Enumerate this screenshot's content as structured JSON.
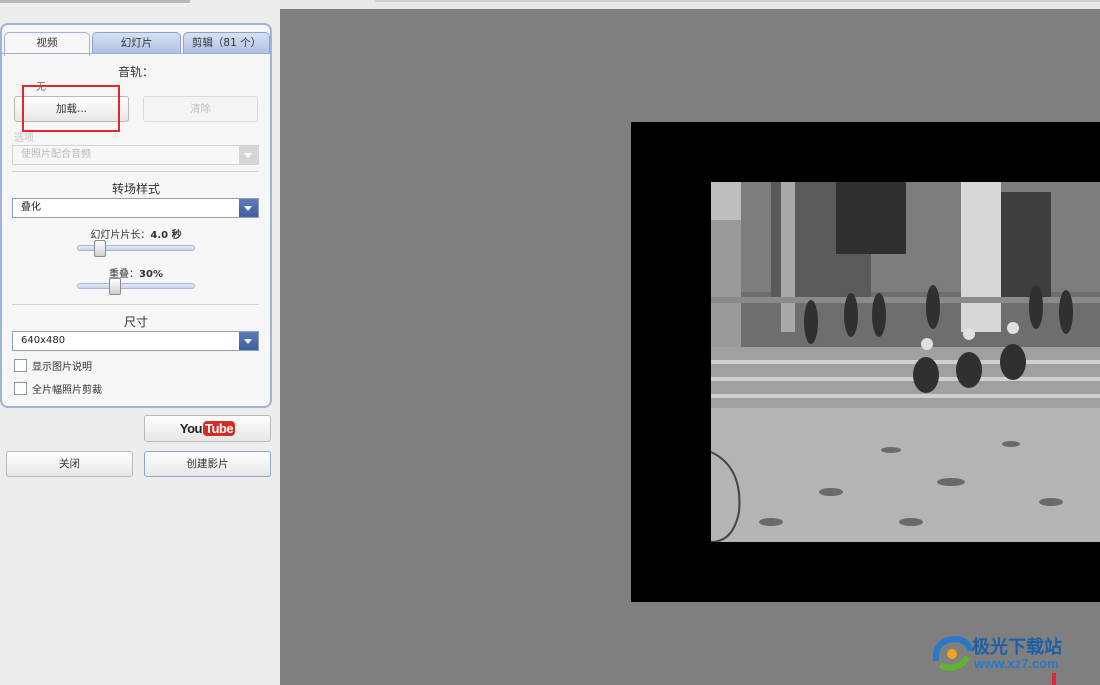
{
  "tabs": [
    {
      "label": "视频",
      "active": true
    },
    {
      "label": "幻灯片",
      "active": false
    },
    {
      "label": "剪辑（81 个）",
      "active": false
    }
  ],
  "audio": {
    "title": "音轨：",
    "track_value": "无",
    "load_button": "加载...",
    "clear_button": "清除",
    "options_label": "选项",
    "fit_select": "使照片配合音频"
  },
  "transition": {
    "title": "转场样式",
    "selected": "叠化",
    "duration_label": "幻灯片片长：",
    "duration_value": "4.0 秒",
    "overlap_label": "重叠：",
    "overlap_value": "30%"
  },
  "size": {
    "title": "尺寸",
    "selected": "640x480"
  },
  "checkboxes": [
    {
      "label": "显示图片说明",
      "checked": false
    },
    {
      "label": "全片幅照片剪裁",
      "checked": false
    }
  ],
  "buttons": {
    "youtube_you": "You",
    "youtube_tube": "Tube",
    "close": "关闭",
    "create": "创建影片"
  },
  "watermark": {
    "name": "极光下载站",
    "url": "www.xz7.com"
  },
  "colors": {
    "accent": "#9fb3d8",
    "highlight": "#e0282f",
    "preview_bg": "#7f7f7f"
  }
}
